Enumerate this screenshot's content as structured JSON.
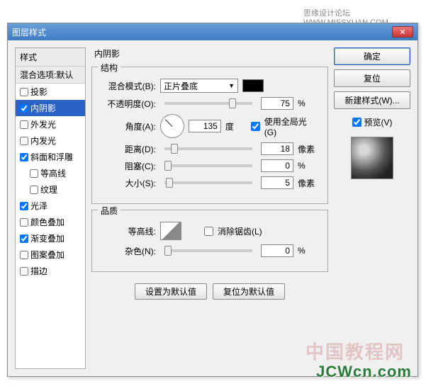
{
  "header_text": "思缘设计论坛  WWW.MISSYUAN.COM",
  "dialog_title": "图层样式",
  "close_text": "✕",
  "styles_panel": {
    "header": "样式",
    "blend_header": "混合选项:默认",
    "items": [
      {
        "label": "投影",
        "checked": false
      },
      {
        "label": "内阴影",
        "checked": true,
        "selected": true
      },
      {
        "label": "外发光",
        "checked": false
      },
      {
        "label": "内发光",
        "checked": false
      },
      {
        "label": "斜面和浮雕",
        "checked": true
      },
      {
        "label": "等高线",
        "checked": false,
        "sub": true
      },
      {
        "label": "纹理",
        "checked": false,
        "sub": true
      },
      {
        "label": "光泽",
        "checked": true
      },
      {
        "label": "颜色叠加",
        "checked": false
      },
      {
        "label": "渐变叠加",
        "checked": true
      },
      {
        "label": "图案叠加",
        "checked": false
      },
      {
        "label": "描边",
        "checked": false
      }
    ]
  },
  "section_title": "内阴影",
  "structure": {
    "legend": "结构",
    "blend_mode_label": "混合模式(B):",
    "blend_mode_value": "正片叠底",
    "opacity_label": "不透明度(O):",
    "opacity_value": "75",
    "opacity_unit": "%",
    "angle_label": "角度(A):",
    "angle_value": "135",
    "angle_unit": "度",
    "global_light_label": "使用全局光(G)",
    "global_light_checked": true,
    "distance_label": "距离(D):",
    "distance_value": "18",
    "distance_unit": "像素",
    "choke_label": "阻塞(C):",
    "choke_value": "0",
    "choke_unit": "%",
    "size_label": "大小(S):",
    "size_value": "5",
    "size_unit": "像素"
  },
  "quality": {
    "legend": "品质",
    "contour_label": "等高线:",
    "antialias_label": "消除锯齿(L)",
    "antialias_checked": false,
    "noise_label": "杂色(N):",
    "noise_value": "0",
    "noise_unit": "%"
  },
  "buttons": {
    "make_default": "设置为默认值",
    "reset_default": "复位为默认值"
  },
  "right": {
    "ok": "确定",
    "reset": "复位",
    "new_style": "新建样式(W)...",
    "preview_label": "预览(V)",
    "preview_checked": true
  },
  "watermark1": "中国教程网",
  "watermark2": "JCWcn.com"
}
